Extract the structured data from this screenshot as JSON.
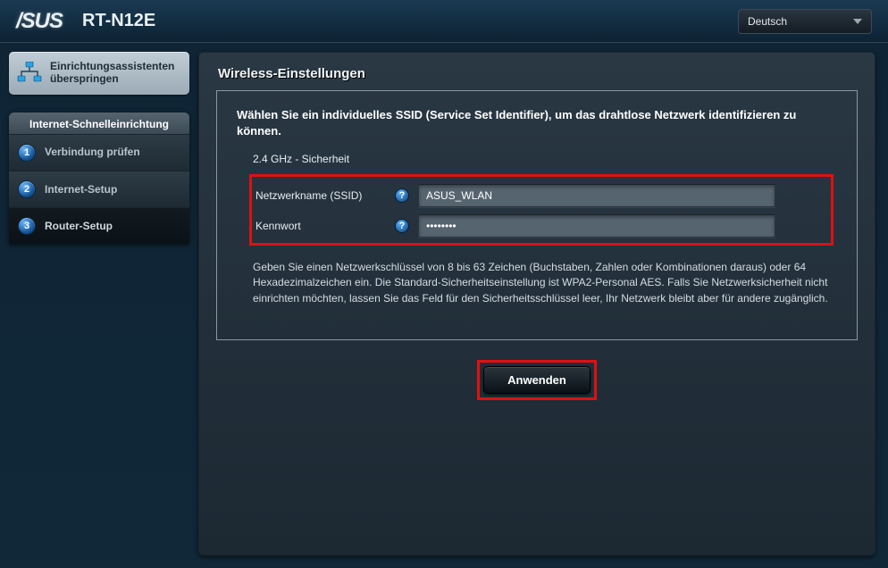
{
  "header": {
    "brand": "/SUS",
    "model": "RT-N12E",
    "language": "Deutsch"
  },
  "sidebar": {
    "skip_label": "Einrichtungsassistenten überspringen",
    "wizard_title": "Internet-Schnelleinrichtung",
    "steps": [
      {
        "num": "1",
        "label": "Verbindung prüfen",
        "active": false
      },
      {
        "num": "2",
        "label": "Internet-Setup",
        "active": false
      },
      {
        "num": "3",
        "label": "Router-Setup",
        "active": true
      }
    ]
  },
  "panel": {
    "title": "Wireless-Einstellungen",
    "intro": "Wählen Sie ein individuelles SSID (Service Set Identifier), um das drahtlose Netzwerk identifizieren zu können.",
    "section_label": "2.4 GHz - Sicherheit",
    "ssid_label": "Netzwerkname (SSID)",
    "ssid_value": "ASUS_WLAN",
    "password_label": "Kennwort",
    "password_value": "••••••••",
    "description": "Geben Sie einen Netzwerkschlüssel von 8 bis 63 Zeichen (Buchstaben, Zahlen oder Kombinationen daraus) oder 64 Hexadezimalzeichen ein. Die Standard-Sicherheitseinstellung ist WPA2-Personal AES. Falls Sie Netzwerksicherheit nicht einrichten möchten, lassen Sie das Feld für den Sicherheitsschlüssel leer, Ihr Netzwerk bleibt aber für andere zugänglich.",
    "apply_label": "Anwenden"
  },
  "colors": {
    "highlight": "#e01010",
    "accent": "#1a5a9e"
  }
}
